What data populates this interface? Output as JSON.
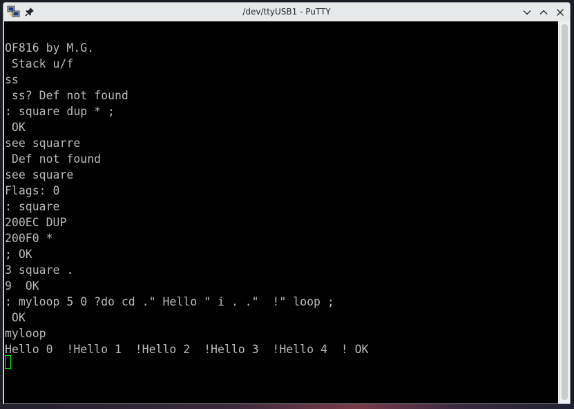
{
  "window": {
    "title": "/dev/ttyUSB1 - PuTTY"
  },
  "icons": {
    "app": "putty-app-icon",
    "pin": "pin-icon",
    "minimize": "chevron-down-icon",
    "maximize": "chevron-up-icon",
    "close": "close-icon"
  },
  "terminal": {
    "lines": [
      "OF816 by M.G.",
      " Stack u/f",
      "ss",
      " ss? Def not found",
      ": square dup * ;",
      " OK",
      "see squarre",
      " Def not found",
      "see square",
      "Flags: 0",
      ": square",
      "200EC DUP",
      "200F0 *",
      "; OK",
      "3 square .",
      "9  OK",
      ": myloop 5 0 ?do cd .\" Hello \" i . .\"  !\" loop ;",
      " OK",
      "myloop",
      "Hello 0  !Hello 1  !Hello 2  !Hello 3  !Hello 4  ! OK"
    ]
  },
  "colors": {
    "terminal_bg": "#000000",
    "terminal_fg": "#bbbbbb",
    "cursor": "#00ff00"
  }
}
